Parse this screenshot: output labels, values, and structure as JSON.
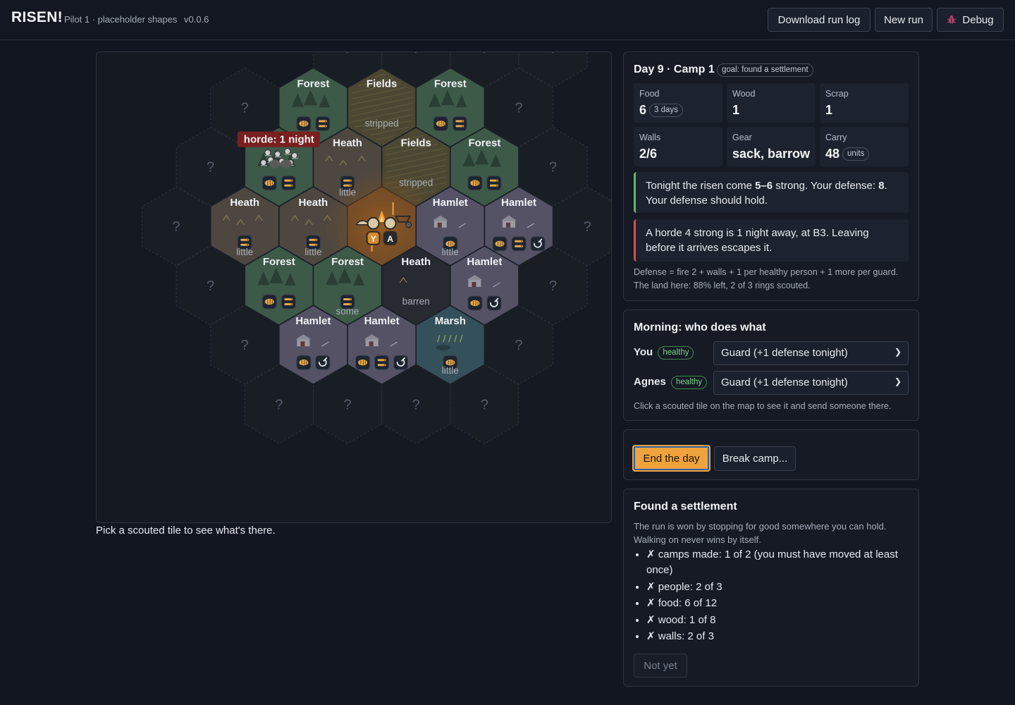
{
  "header": {
    "title": "RISEN!",
    "subtitle": "Pilot 1 · placeholder shapes",
    "version": "v0.0.6",
    "download_label": "Download run log",
    "new_run_label": "New run",
    "debug_label": "Debug",
    "debug_icon": "bug-icon"
  },
  "map": {
    "hint": "Pick a scouted tile to see what's there.",
    "horde_badge": "horde: 1 night",
    "unknown_mark": "?",
    "unknown_tiles": [
      {
        "r": -4,
        "c": 0
      },
      {
        "r": -4,
        "c": 1
      },
      {
        "r": -4,
        "c": 2
      },
      {
        "r": -4,
        "c": 3
      },
      {
        "r": -3,
        "c": -1.5
      },
      {
        "r": -3,
        "c": 2.5
      },
      {
        "r": -2,
        "c": -2
      },
      {
        "r": -2,
        "c": 3
      },
      {
        "r": -1,
        "c": -2.5
      },
      {
        "r": -1,
        "c": 3.5
      },
      {
        "r": 0,
        "c": -2
      },
      {
        "r": 0,
        "c": 3
      },
      {
        "r": 1,
        "c": -1.5
      },
      {
        "r": 1,
        "c": 2.5
      },
      {
        "r": 2,
        "c": -1
      },
      {
        "r": 2,
        "c": 0
      },
      {
        "r": 2,
        "c": 1
      },
      {
        "r": 2,
        "c": 2
      }
    ],
    "tiles": [
      {
        "name": "Forest",
        "terrain": "forest",
        "r": -3,
        "c": -0.5,
        "icons": [
          "food",
          "wood"
        ],
        "sub": ""
      },
      {
        "name": "Fields",
        "terrain": "fields",
        "r": -3,
        "c": 0.5,
        "icons": [],
        "sub": "stripped"
      },
      {
        "name": "Forest",
        "terrain": "forest",
        "r": -3,
        "c": 1.5,
        "icons": [
          "food",
          "wood"
        ],
        "sub": ""
      },
      {
        "name": "",
        "terrain": "forest",
        "r": -2,
        "c": -1,
        "icons": [
          "food",
          "wood"
        ],
        "sub": "",
        "horde": true
      },
      {
        "name": "Heath",
        "terrain": "heath",
        "r": -2,
        "c": 0,
        "icons": [
          "wood"
        ],
        "sub": "little"
      },
      {
        "name": "Fields",
        "terrain": "fields",
        "r": -2,
        "c": 1,
        "icons": [],
        "sub": "stripped"
      },
      {
        "name": "Forest",
        "terrain": "forest",
        "r": -2,
        "c": 2,
        "icons": [
          "food",
          "wood"
        ],
        "sub": ""
      },
      {
        "name": "Heath",
        "terrain": "heath",
        "r": -1,
        "c": -1.5,
        "icons": [
          "wood"
        ],
        "sub": "little"
      },
      {
        "name": "Heath",
        "terrain": "heath",
        "r": -1,
        "c": -0.5,
        "icons": [
          "wood"
        ],
        "sub": "little"
      },
      {
        "name": "",
        "terrain": "camp",
        "r": -1,
        "c": 0.5,
        "icons": [],
        "sub": ""
      },
      {
        "name": "Hamlet",
        "terrain": "hamlet",
        "r": -1,
        "c": 1.5,
        "icons": [
          "food"
        ],
        "sub": "little"
      },
      {
        "name": "Hamlet",
        "terrain": "hamlet",
        "r": -1,
        "c": 2.5,
        "icons": [
          "food",
          "wood",
          "scrap"
        ],
        "sub": ""
      },
      {
        "name": "Forest",
        "terrain": "forest",
        "r": 0,
        "c": -1,
        "icons": [
          "food",
          "wood"
        ],
        "sub": ""
      },
      {
        "name": "Forest",
        "terrain": "forest",
        "r": 0,
        "c": 0,
        "icons": [
          "wood"
        ],
        "sub": "some"
      },
      {
        "name": "Heath",
        "terrain": "barren",
        "r": 0,
        "c": 1,
        "icons": [],
        "sub": "barren"
      },
      {
        "name": "Hamlet",
        "terrain": "hamlet",
        "r": 0,
        "c": 2,
        "icons": [
          "food",
          "scrap"
        ],
        "sub": ""
      },
      {
        "name": "Hamlet",
        "terrain": "hamlet",
        "r": 1,
        "c": -0.5,
        "icons": [
          "food",
          "scrap"
        ],
        "sub": ""
      },
      {
        "name": "Hamlet",
        "terrain": "hamlet",
        "r": 1,
        "c": 0.5,
        "icons": [
          "food",
          "wood",
          "scrap"
        ],
        "sub": ""
      },
      {
        "name": "Marsh",
        "terrain": "marsh",
        "r": 1,
        "c": 1.5,
        "icons": [
          "food"
        ],
        "sub": "little"
      }
    ],
    "tokens": [
      "Y",
      "A"
    ],
    "terrain_colors": {
      "forest": "#3d5a48",
      "fields": "#4b4732",
      "heath": "#4d473f",
      "hamlet": "#555266",
      "marsh": "#34505a",
      "barren": "#272a31",
      "camp": "#6a4a2a",
      "unknown": "#191d24"
    }
  },
  "status": {
    "title": "Day 9 · Camp 1",
    "goal": "goal: found a settlement",
    "stats": [
      {
        "label": "Food",
        "value": "6",
        "pill": "3 days"
      },
      {
        "label": "Wood",
        "value": "1",
        "pill": ""
      },
      {
        "label": "Scrap",
        "value": "1",
        "pill": ""
      },
      {
        "label": "Walls",
        "value": "2/6",
        "pill": ""
      },
      {
        "label": "Gear",
        "value": "sack, barrow",
        "pill": ""
      },
      {
        "label": "Carry",
        "value": "48",
        "pill": "units"
      }
    ],
    "defense_alert_pre": "Tonight the risen come ",
    "defense_alert_strength": "5–6",
    "defense_alert_mid": " strong. Your defense: ",
    "defense_alert_value": "8",
    "defense_alert_post": ". Your defense should hold.",
    "horde_alert": "A horde 4 strong is 1 night away, at B3. Leaving before it arrives escapes it.",
    "formula": "Defense = fire 2 + walls + 1 per healthy person + 1 more per guard.",
    "land": "The land here: 88% left, 2 of 3 rings scouted."
  },
  "morning": {
    "title": "Morning: who does what",
    "people": [
      {
        "name": "You",
        "health": "healthy",
        "task": "Guard (+1 defense tonight)"
      },
      {
        "name": "Agnes",
        "health": "healthy",
        "task": "Guard (+1 defense tonight)"
      }
    ],
    "hint": "Click a scouted tile on the map to see it and send someone there."
  },
  "actions": {
    "end_day": "End the day",
    "break_camp": "Break camp..."
  },
  "settlement": {
    "title": "Found a settlement",
    "description": "The run is won by stopping for good somewhere you can hold. Walking on never wins by itself.",
    "requirements": [
      "✗ camps made: 1 of 2 (you must have moved at least once)",
      "✗ people: 2 of 3",
      "✗ food: 6 of 12",
      "✗ wood: 1 of 8",
      "✗ walls: 2 of 3"
    ],
    "not_yet": "Not yet"
  }
}
